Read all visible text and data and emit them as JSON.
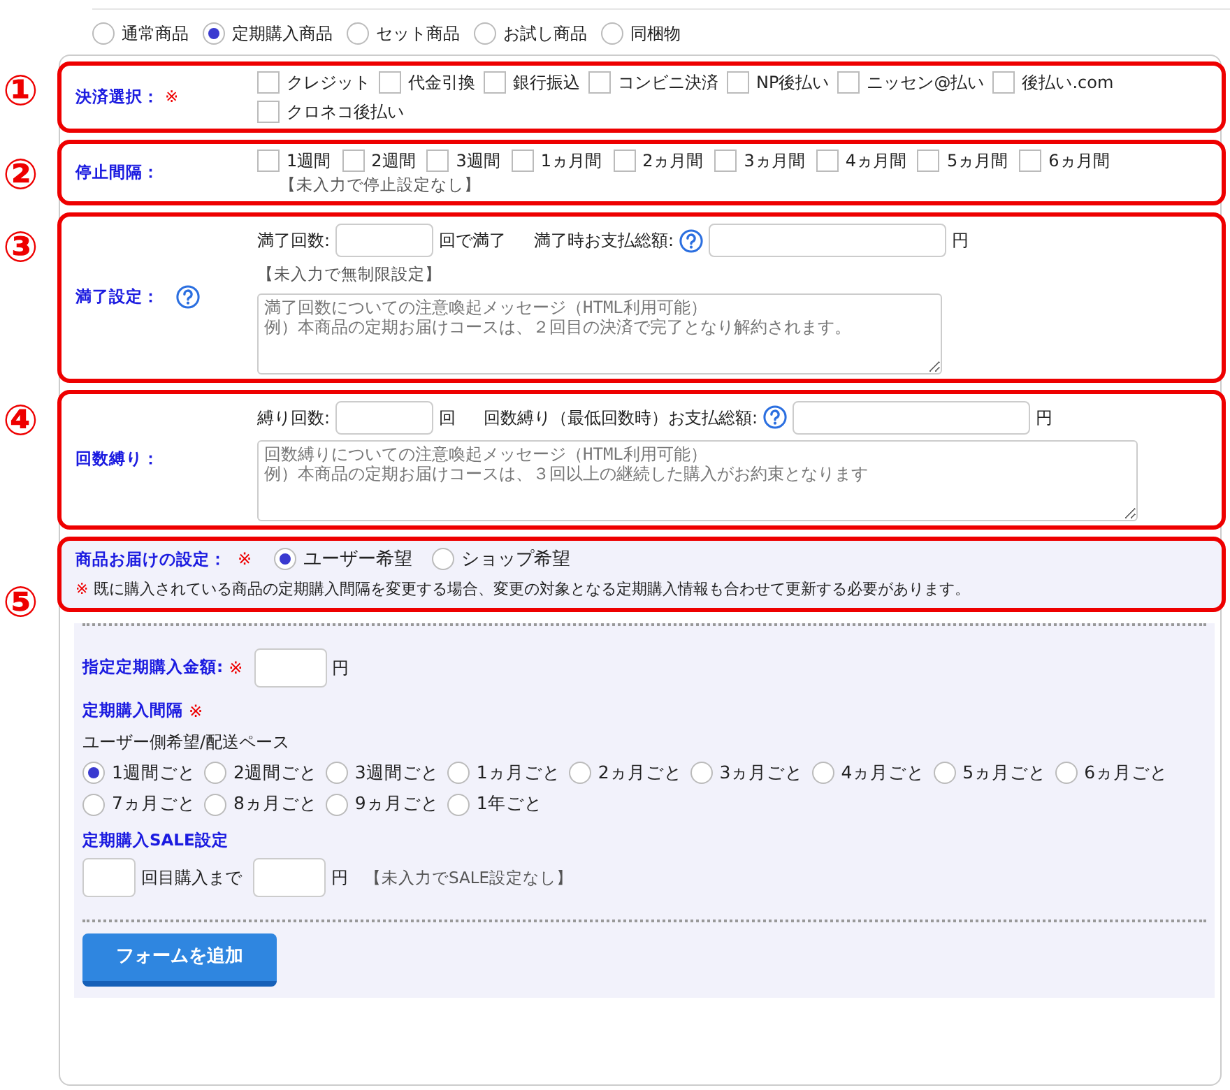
{
  "product_types": [
    {
      "label": "通常商品",
      "selected": false
    },
    {
      "label": "定期購入商品",
      "selected": true
    },
    {
      "label": "セット商品",
      "selected": false
    },
    {
      "label": "お試し商品",
      "selected": false
    },
    {
      "label": "同梱物",
      "selected": false
    }
  ],
  "payment": {
    "marker": "①",
    "label": "決済選択：",
    "required": "※",
    "options": [
      {
        "label": "クレジット",
        "checked": false
      },
      {
        "label": "代金引換",
        "checked": false
      },
      {
        "label": "銀行振込",
        "checked": false
      },
      {
        "label": "コンビニ決済",
        "checked": false
      },
      {
        "label": "NP後払い",
        "checked": false
      },
      {
        "label": "ニッセン@払い",
        "checked": false
      },
      {
        "label": "後払い.com",
        "checked": false
      },
      {
        "label": "クロネコ後払い",
        "checked": false
      }
    ]
  },
  "stop_interval": {
    "marker": "②",
    "label": "停止間隔：",
    "options": [
      {
        "label": "1週間",
        "checked": false
      },
      {
        "label": "2週間",
        "checked": false
      },
      {
        "label": "3週間",
        "checked": false
      },
      {
        "label": "1ヵ月間",
        "checked": false
      },
      {
        "label": "2ヵ月間",
        "checked": false
      },
      {
        "label": "3ヵ月間",
        "checked": false
      },
      {
        "label": "4ヵ月間",
        "checked": false
      },
      {
        "label": "5ヵ月間",
        "checked": false
      },
      {
        "label": "6ヵ月間",
        "checked": false
      }
    ],
    "note": "【未入力で停止設定なし】"
  },
  "completion": {
    "marker": "③",
    "label": "満了設定：",
    "count_label": "満了回数:",
    "count_suffix": "回で満了",
    "total_label": "満了時お支払総額:",
    "total_suffix": "円",
    "note": "【未入力で無制限設定】",
    "message_placeholder": [
      "満了回数についての注意喚起メッセージ（HTML利用可能）",
      "例）本商品の定期お届けコースは、２回目の決済で完了となり解約されます。"
    ]
  },
  "binding": {
    "marker": "④",
    "label": "回数縛り：",
    "count_label": "縛り回数:",
    "count_suffix": "回",
    "total_label": "回数縛り（最低回数時）お支払総額:",
    "total_suffix": "円",
    "message_placeholder": [
      "回数縛りについての注意喚起メッセージ（HTML利用可能）",
      "例）本商品の定期お届けコースは、３回以上の継続した購入がお約束となります"
    ]
  },
  "delivery": {
    "marker": "⑤",
    "label": "商品お届けの設定：",
    "required": "※",
    "options": [
      {
        "label": "ユーザー希望",
        "selected": true
      },
      {
        "label": "ショップ希望",
        "selected": false
      }
    ],
    "note_mark": "※",
    "note": "既に購入されている商品の定期購入間隔を変更する場合、変更の対象となる定期購入情報も合わせて更新する必要があります。"
  },
  "amount": {
    "label": "指定定期購入金額:",
    "required": "※",
    "suffix": "円"
  },
  "interval": {
    "label": "定期購入間隔",
    "required": "※",
    "sublabel": "ユーザー側希望/配送ペース",
    "options": [
      {
        "label": "1週間ごと",
        "selected": true
      },
      {
        "label": "2週間ごと",
        "selected": false
      },
      {
        "label": "3週間ごと",
        "selected": false
      },
      {
        "label": "1ヵ月ごと",
        "selected": false
      },
      {
        "label": "2ヵ月ごと",
        "selected": false
      },
      {
        "label": "3ヵ月ごと",
        "selected": false
      },
      {
        "label": "4ヵ月ごと",
        "selected": false
      },
      {
        "label": "5ヵ月ごと",
        "selected": false
      },
      {
        "label": "6ヵ月ごと",
        "selected": false
      },
      {
        "label": "7ヵ月ごと",
        "selected": false
      },
      {
        "label": "8ヵ月ごと",
        "selected": false
      },
      {
        "label": "9ヵ月ごと",
        "selected": false
      },
      {
        "label": "1年ごと",
        "selected": false
      }
    ]
  },
  "sale": {
    "label": "定期購入SALE設定",
    "count_suffix": "回目購入まで",
    "price_suffix": "円",
    "note": "【未入力でSALE設定なし】"
  },
  "add_button": "フォームを追加"
}
